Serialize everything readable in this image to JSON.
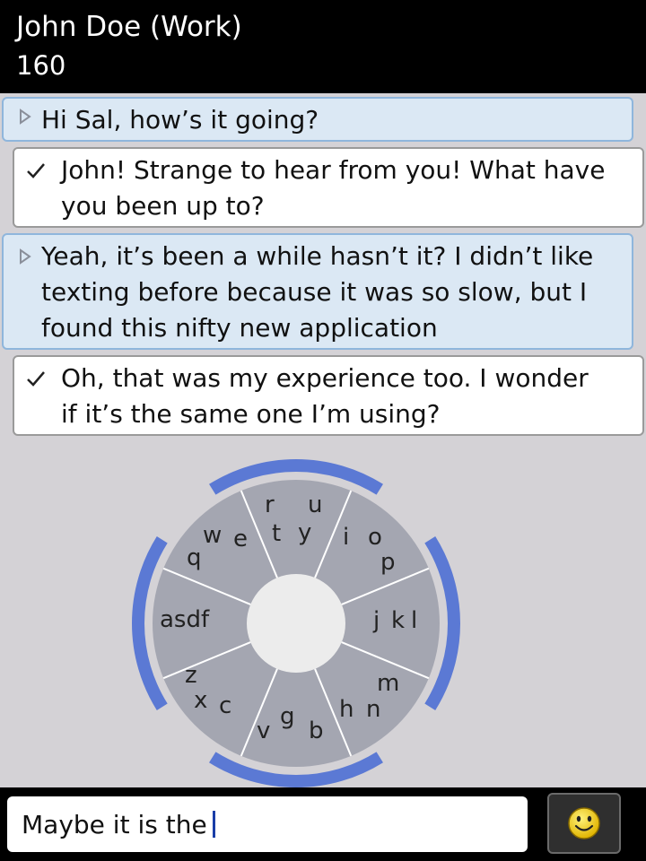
{
  "header": {
    "contact_name": "John Doe (Work)",
    "char_count": "160"
  },
  "messages": [
    {
      "direction": "received",
      "lines": [
        "Hi Sal, how’s it going?"
      ]
    },
    {
      "direction": "sent",
      "lines": [
        "John! Strange to hear from you! What have",
        "you been up to?"
      ]
    },
    {
      "direction": "received",
      "lines": [
        "Yeah, it’s been a while hasn’t it? I didn’t like",
        "texting before because it was so slow, but I",
        "found this nifty new application"
      ]
    },
    {
      "direction": "sent",
      "lines": [
        "Oh, that was my experience too. I wonder",
        "if it’s the same one I’m using?"
      ]
    }
  ],
  "keyboard": {
    "keys": [
      "q",
      "w",
      "e",
      "r",
      "t",
      "y",
      "u",
      "i",
      "o",
      "p",
      "j",
      "k",
      "l",
      "m",
      "h",
      "n",
      "b",
      "g",
      "v",
      "c",
      "x",
      "z",
      "asdf"
    ],
    "colors": {
      "sector": "#a4a6b1",
      "divider": "#ffffff",
      "center": "#ececec",
      "arc": "#5b79d4"
    }
  },
  "input": {
    "value": "Maybe it is the",
    "send_icon": "smiley-icon"
  }
}
